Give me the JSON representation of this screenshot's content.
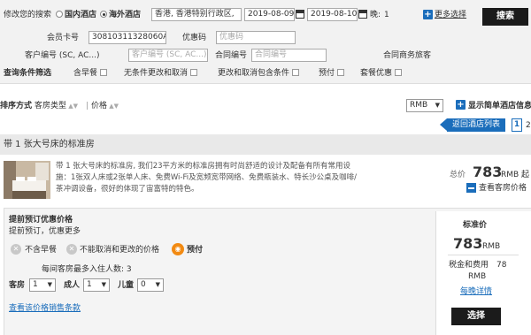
{
  "search": {
    "modify_label": "修改您的搜索",
    "domestic_label": "国内酒店",
    "overseas_label": "海外酒店",
    "destination_value": "香港, 香港特别行政区,",
    "checkin_value": "2019-08-09",
    "checkout_value": "2019-08-10",
    "nights_label": "晚:",
    "nights_value": "1",
    "more_options_label": "更多选择",
    "search_button_label": "搜索",
    "member_card_label": "会员卡号",
    "member_card_value": "30810311328060A",
    "promo_label": "优惠码",
    "promo_placeholder": "优惠码",
    "client_number_label": "客户编号 (SC, AC...)",
    "client_number_placeholder": "客户编号 (SC, AC...)",
    "contract_number_label": "合同编号",
    "contract_number_placeholder": "合同编号",
    "contract_traveler_label": "合同商务旅客",
    "filter_label": "查询条件筛选",
    "filters": [
      "含早餐",
      "无条件更改和取消",
      "更改和取消包含条件",
      "预付",
      "套餐优惠"
    ]
  },
  "sortbar": {
    "sort_label": "排序方式",
    "sort_room_type": "客房类型",
    "sort_price": "价格",
    "currency_value": "RMB",
    "show_simple_list_label": "显示简单酒店信息",
    "back_to_list_label": "返回酒店列表",
    "page_current": "1",
    "page_next": "2"
  },
  "room": {
    "title": "带 1 张大号床的标准房",
    "description": "带 1 张大号床的标准房, 我们23平方米的标准房拥有时尚舒适的设计及配备有所有常用设施：1张双人床或2张单人床、免费Wi-Fi及宽频宽带网络、免费瓶装水、特长沙公桌及咖啡/茶冲调设备，很好的体现了宙富特的特色。",
    "total_label": "总价",
    "total_price": "783",
    "total_currency": "RMB 起",
    "view_rooms_label": "查看客房价格"
  },
  "rate": {
    "title": "提前预订优惠价格",
    "subtitle": "提前预订，优惠更多",
    "features": [
      "不含早餐",
      "不能取消和更改的价格",
      "预付"
    ],
    "max_guests_label": "每间客房最多入住人数: 3",
    "rooms_label": "客房",
    "rooms_value": "1",
    "adults_label": "成人",
    "adults_value": "1",
    "children_label": "儿童",
    "children_value": "0",
    "terms_link": "查看该价格销售条款",
    "standard_price_label": "标准价",
    "price": "783",
    "price_currency": "RMB",
    "tax_label": "税金和费用",
    "tax_value": "78",
    "tax_currency": "RMB",
    "nightly_details_link": "每晚详情",
    "select_button_label": "选择"
  },
  "colors": {
    "accent_blue": "#1a6dbb",
    "dark_button": "#1b1b1b",
    "prepaid_orange": "#f28a12"
  }
}
